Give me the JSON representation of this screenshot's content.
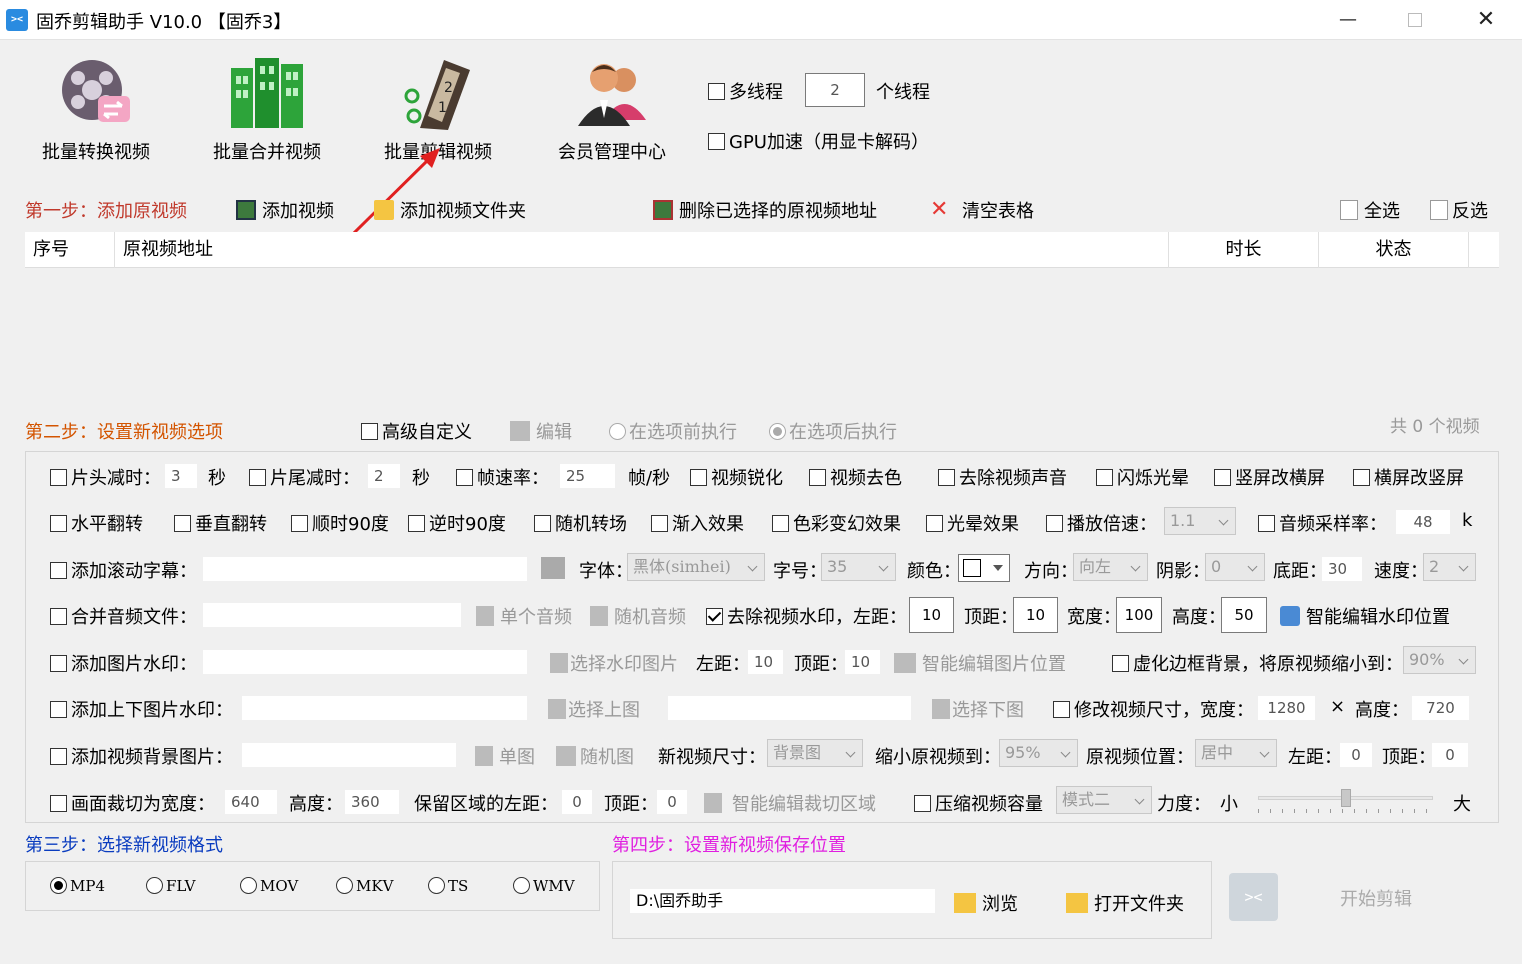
{
  "window": {
    "title": "固乔剪辑助手 V10.0 【固乔3】",
    "app_icon": "scissors-icon"
  },
  "toolbar": {
    "items": [
      {
        "label": "批量转换视频",
        "icon": "film-reel-convert-icon"
      },
      {
        "label": "批量合并视频",
        "icon": "merge-building-icon"
      },
      {
        "label": "批量剪辑视频",
        "icon": "film-strip-icon"
      },
      {
        "label": "会员管理中心",
        "icon": "users-icon"
      }
    ],
    "multithread_label": "多线程",
    "thread_count": "2",
    "thread_unit": "个线程",
    "gpu_label": "GPU加速（用显卡解码）"
  },
  "step1": {
    "title": "第一步：添加原视频",
    "add_video": "添加视频",
    "add_folder": "添加视频文件夹",
    "delete_selected": "删除已选择的原视频地址",
    "clear_table": "清空表格",
    "select_all": "全选",
    "invert_select": "反选",
    "columns": [
      "序号",
      "原视频地址",
      "时长",
      "状态"
    ]
  },
  "step2": {
    "title": "第二步：设置新视频选项",
    "advanced": "高级自定义",
    "edit": "编辑",
    "before": "在选项前执行",
    "after": "在选项后执行",
    "count_prefix": "共",
    "count": "0",
    "count_suffix": "个视频",
    "row1": {
      "head_cut": "片头减时：",
      "head_val": "3",
      "sec1": "秒",
      "tail_cut": "片尾减时：",
      "tail_val": "2",
      "sec2": "秒",
      "fps": "帧速率：",
      "fps_val": "25",
      "fps_unit": "帧/秒",
      "sharpen": "视频锐化",
      "decolor": "视频去色",
      "mute": "去除视频声音",
      "flash": "闪烁光晕",
      "v2h": "竖屏改横屏",
      "h2v": "横屏改竖屏"
    },
    "row2": {
      "hflip": "水平翻转",
      "vflip": "垂直翻转",
      "cw90": "顺时90度",
      "ccw90": "逆时90度",
      "rand_trans": "随机转场",
      "fade_in": "渐入效果",
      "color_fx": "色彩变幻效果",
      "halo": "光晕效果",
      "speed": "播放倍速：",
      "speed_val": "1.1",
      "samplerate": "音频采样率：",
      "samplerate_val": "48",
      "samplerate_unit": "k"
    },
    "row3": {
      "scroll_sub": "添加滚动字幕：",
      "font": "字体：",
      "font_val": "黑体(simhei)",
      "size": "字号：",
      "size_val": "35",
      "color": "颜色：",
      "direction": "方向：",
      "direction_val": "向左",
      "shadow": "阴影：",
      "shadow_val": "0",
      "bottom": "底距：",
      "bottom_val": "30",
      "speed": "速度：",
      "speed_val": "2"
    },
    "row4": {
      "merge_audio": "合并音频文件：",
      "single_audio": "单个音频",
      "random_audio": "随机音频",
      "remove_wm": "去除视频水印，左距：",
      "left_val": "10",
      "top": "顶距：",
      "top_val": "10",
      "width": "宽度：",
      "width_val": "100",
      "height": "高度：",
      "height_val": "50",
      "smart_wm": "智能编辑水印位置"
    },
    "row5": {
      "img_wm": "添加图片水印：",
      "choose_wm": "选择水印图片",
      "left": "左距：",
      "left_val": "10",
      "top": "顶距：",
      "top_val": "10",
      "smart_img": "智能编辑图片位置",
      "blur_bg": "虚化边框背景，将原视频缩小到：",
      "blur_val": "90%"
    },
    "row6": {
      "topbottom_wm": "添加上下图片水印：",
      "choose_top": "选择上图",
      "choose_bottom": "选择下图",
      "resize": "修改视频尺寸，宽度：",
      "w_val": "1280",
      "times": "×",
      "height": "高度：",
      "h_val": "720"
    },
    "row7": {
      "bg_img": "添加视频背景图片：",
      "single_img": "单图",
      "random_img": "随机图",
      "new_size": "新视频尺寸：",
      "new_size_val": "背景图",
      "shrink": "缩小原视频到：",
      "shrink_val": "95%",
      "pos": "原视频位置：",
      "pos_val": "居中",
      "left": "左距：",
      "left_val": "0",
      "top": "顶距：",
      "top_val": "0"
    },
    "row8": {
      "crop": "画面裁切为宽度：",
      "crop_w": "640",
      "height": "高度：",
      "crop_h": "360",
      "keep_left": "保留区域的左距：",
      "keep_left_val": "0",
      "top": "顶距：",
      "top_val": "0",
      "smart_crop": "智能编辑裁切区域",
      "compress": "压缩视频容量",
      "mode_val": "模式二",
      "strength": "力度：",
      "small": "小",
      "big": "大",
      "slider_level": 0.5
    }
  },
  "step3": {
    "title": "第三步：选择新视频格式",
    "formats": [
      "MP4",
      "FLV",
      "MOV",
      "MKV",
      "TS",
      "WMV"
    ]
  },
  "step4": {
    "title": "第四步：设置新视频保存位置",
    "path": "D:\\固乔助手",
    "browse": "浏览",
    "open_folder": "打开文件夹",
    "start": "开始剪辑"
  }
}
